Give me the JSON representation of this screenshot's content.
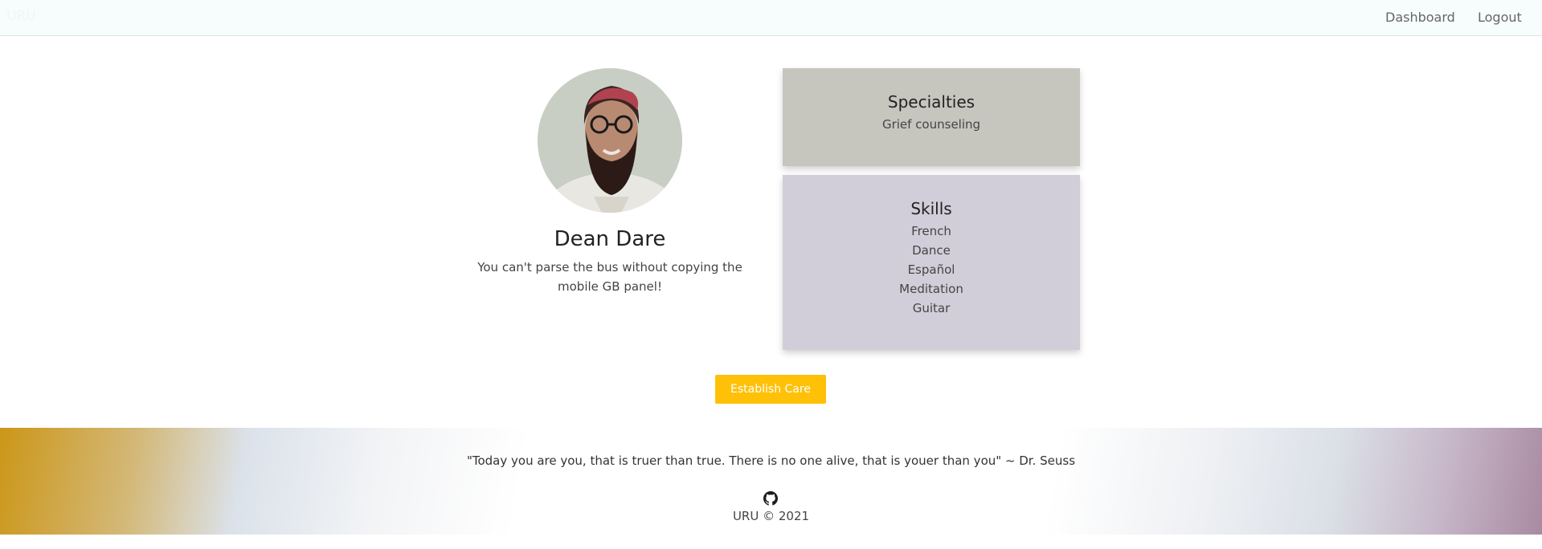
{
  "navbar": {
    "brand": "URU",
    "links": [
      {
        "label": "Dashboard"
      },
      {
        "label": "Logout"
      }
    ]
  },
  "profile": {
    "name": "Dean Dare",
    "bio": "You can't parse the bus without copying the mobile GB panel!"
  },
  "specialties": {
    "title": "Specialties",
    "items": [
      "Grief counseling"
    ]
  },
  "skills": {
    "title": "Skills",
    "items": [
      "French",
      "Dance",
      "Español",
      "Meditation",
      "Guitar"
    ]
  },
  "actions": {
    "establish_label": "Establish Care"
  },
  "footer": {
    "quote": "\"Today you are you, that is truer than true. There is no one alive, that is youer than you\" ~ Dr. Seuss",
    "icon": "github-icon",
    "copyright": "URU © 2021"
  },
  "colors": {
    "accent": "#ffc107",
    "specialties_bg": "#c6c6bf",
    "skills_bg": "#d1ced9"
  }
}
